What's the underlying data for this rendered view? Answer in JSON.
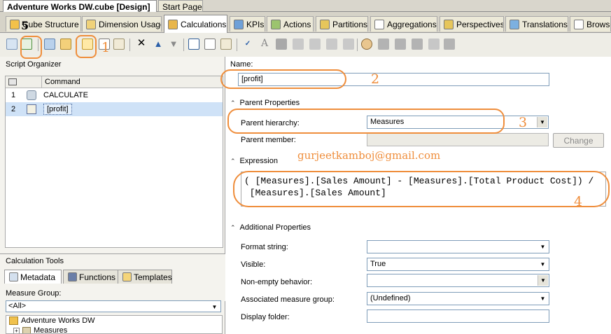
{
  "document_tabs": [
    "Adventure Works DW.cube [Design]",
    "Start Page"
  ],
  "designer_tabs": [
    "Cube Structure",
    "Dimension Usage",
    "Calculations",
    "KPIs",
    "Actions",
    "Partitions",
    "Aggregations",
    "Perspectives",
    "Translations",
    "Browser"
  ],
  "script_organizer": {
    "title": "Script Organizer",
    "column_command": "Command",
    "rows": [
      {
        "num": "1",
        "command": "CALCULATE"
      },
      {
        "num": "2",
        "command": "[profit]"
      }
    ]
  },
  "calc_tools": {
    "title": "Calculation Tools",
    "tabs": [
      "Metadata",
      "Functions",
      "Templates"
    ],
    "measure_group_label": "Measure Group:",
    "measure_group_value": "<All>",
    "tree_items": [
      "Adventure Works DW",
      "Measures"
    ]
  },
  "form": {
    "name_label": "Name:",
    "name_value": "[profit]",
    "parent_properties_label": "Parent Properties",
    "parent_hierarchy_label": "Parent hierarchy:",
    "parent_hierarchy_value": "Measures",
    "parent_member_label": "Parent member:",
    "change_button": "Change",
    "expression_label": "Expression",
    "expression_line1": "( [Measures].[Sales Amount] - [Measures].[Total Product Cost]) /",
    "expression_line2": " [Measures].[Sales Amount]",
    "additional_properties_label": "Additional Properties",
    "format_string_label": "Format string:",
    "visible_label": "Visible:",
    "visible_value": "True",
    "non_empty_label": "Non-empty behavior:",
    "assoc_group_label": "Associated measure group:",
    "assoc_group_value": "(Undefined)",
    "display_folder_label": "Display folder:"
  },
  "annotations": {
    "email": "gurjeetkamboj@gmail.com",
    "numbers": [
      "5",
      "1",
      "2",
      "3",
      "4"
    ]
  },
  "colors": {
    "annotation": "#ef8e3c",
    "selection": "#cfe2f7"
  }
}
